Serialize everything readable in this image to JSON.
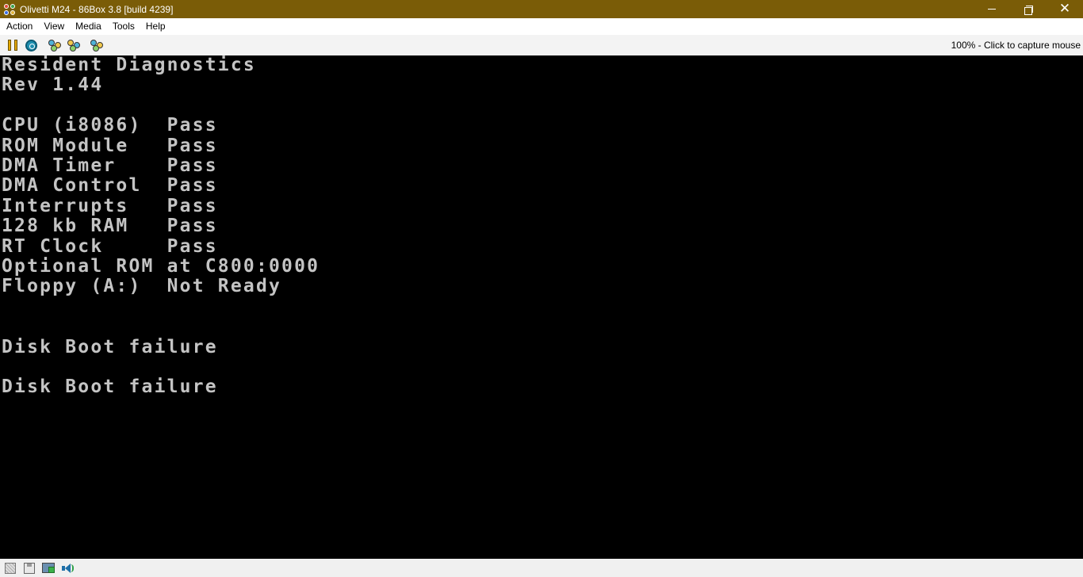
{
  "window": {
    "title": "Olivetti M24  - 86Box 3.8 [build 4239]",
    "controls": {
      "minimize": "minimize",
      "restore": "restore",
      "close": "close"
    }
  },
  "menu": {
    "items": [
      {
        "label": "Action"
      },
      {
        "label": "View"
      },
      {
        "label": "Media"
      },
      {
        "label": "Tools"
      },
      {
        "label": "Help"
      }
    ]
  },
  "toolbar": {
    "buttons": [
      {
        "icon": "pause-icon"
      },
      {
        "icon": "hard-reset-icon"
      },
      {
        "icon": "ctrl-alt-del-icon"
      },
      {
        "icon": "ctrl-alt-esc-icon"
      },
      {
        "icon": "settings-icon"
      }
    ],
    "capture_status": "100% - Click to capture mouse"
  },
  "screen": {
    "fg_color": "#c4c4c4",
    "bg_color": "#000000",
    "lines": [
      "Resident Diagnostics",
      "Rev 1.44",
      "",
      "CPU (i8086)  Pass",
      "ROM Module   Pass",
      "DMA Timer    Pass",
      "DMA Control  Pass",
      "Interrupts   Pass",
      "128 kb RAM   Pass",
      "RT Clock     Pass",
      "Optional ROM at C800:0000",
      "Floppy (A:)  Not Ready",
      "",
      "",
      "Disk Boot failure",
      "",
      "Disk Boot failure"
    ]
  },
  "statusbar": {
    "icons": [
      "cartridge-icon",
      "floppy-drive-icon",
      "network-icon",
      "sound-icon"
    ]
  },
  "colors": {
    "titlebar": "#7a5c07",
    "menubar": "#ffffff",
    "toolbar": "#f3f3f3",
    "statusbar": "#f0f0f0"
  }
}
